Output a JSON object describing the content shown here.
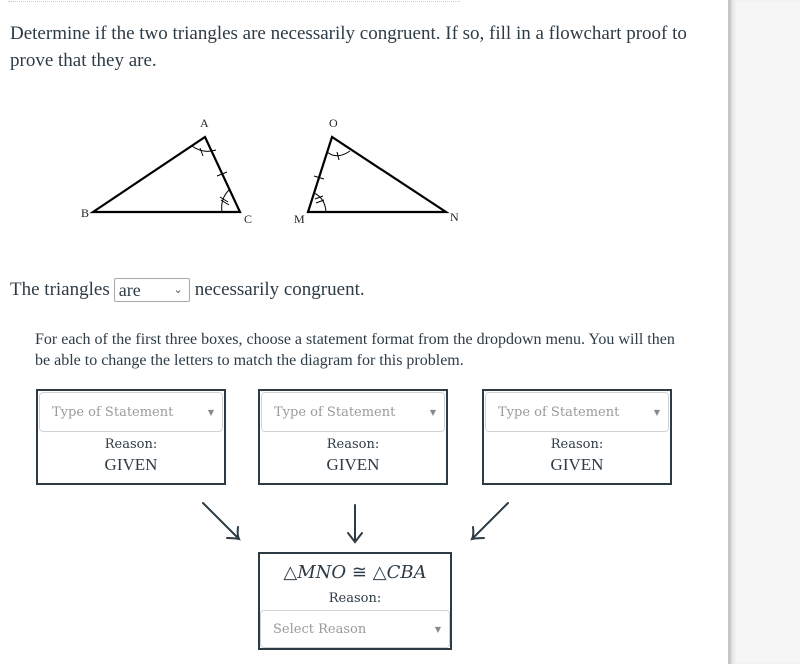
{
  "prompt": "Determine if the two triangles are necessarily congruent. If so, fill in a flowchart proof to prove that they are.",
  "diagram": {
    "triangle1": {
      "labels": [
        "A",
        "B",
        "C"
      ]
    },
    "triangle2": {
      "labels": [
        "O",
        "M",
        "N"
      ]
    }
  },
  "sentence": {
    "before": "The triangles",
    "select_value": "are",
    "after": "necessarily congruent."
  },
  "instructions": "For each of the first three boxes, choose a statement format from the dropdown menu. You will then be able to change the letters to match the diagram for this problem.",
  "boxes": [
    {
      "placeholder": "Type of Statement",
      "reason_label": "Reason:",
      "reason": "GIVEN"
    },
    {
      "placeholder": "Type of Statement",
      "reason_label": "Reason:",
      "reason": "GIVEN"
    },
    {
      "placeholder": "Type of Statement",
      "reason_label": "Reason:",
      "reason": "GIVEN"
    }
  ],
  "conclusion": {
    "tri_symbol": "△",
    "left": "MNO",
    "congruent_symbol": "≅",
    "right": "CBA",
    "reason_label": "Reason:",
    "reason_placeholder": "Select Reason"
  },
  "icons": {
    "chevron": "⌄",
    "caret": "▼"
  }
}
